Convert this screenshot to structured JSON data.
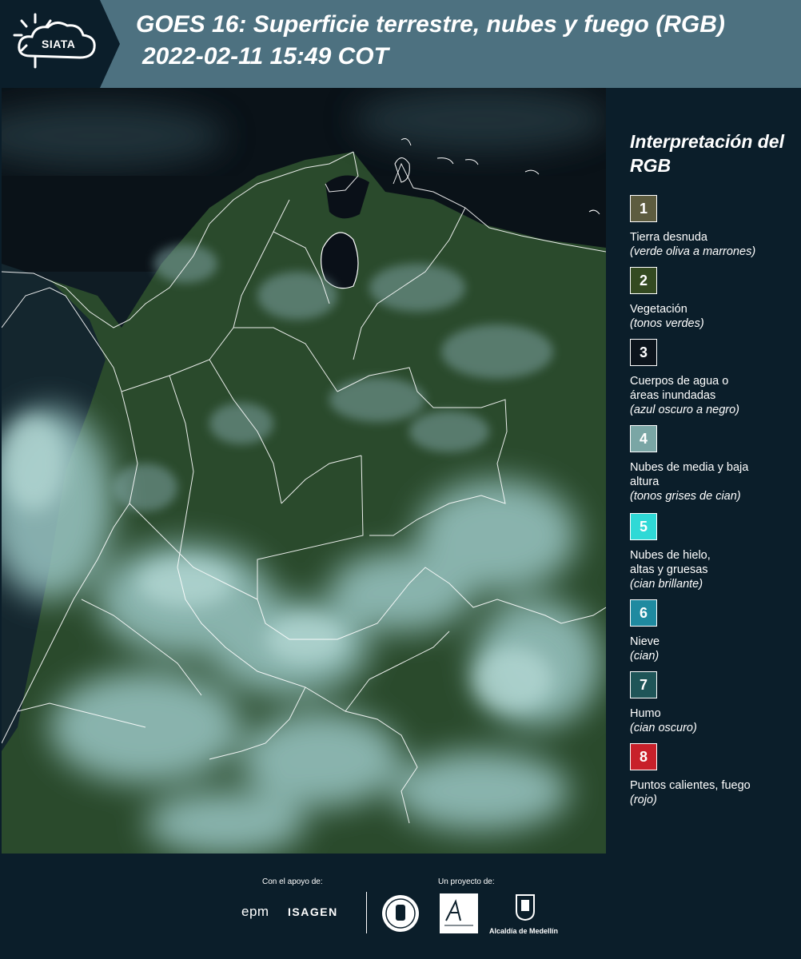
{
  "header": {
    "logo_text": "SIATA",
    "title_line1": "GOES 16: Superficie terrestre, nubes y fuego (RGB)",
    "title_line2": "2022-02-11 15:49 COT"
  },
  "legend": {
    "title": "Interpretación del RGB",
    "items": [
      {
        "number": "1",
        "label": "Tierra desnuda",
        "note": "(verde oliva a marrones)",
        "color": "#5d5c3f"
      },
      {
        "number": "2",
        "label": "Vegetación",
        "note": "(tonos verdes)",
        "color": "#344a21"
      },
      {
        "number": "3",
        "label": "Cuerpos de agua o áreas inundadas",
        "note": "(azul oscuro a negro)",
        "color": "#0c141c"
      },
      {
        "number": "4",
        "label": "Nubes de media y baja altura",
        "note": "(tonos grises de cian)",
        "color": "#7aa6a5"
      },
      {
        "number": "5",
        "label": "Nubes de hielo, altas y gruesas",
        "note": "(cian brillante)",
        "color": "#2fd9d6"
      },
      {
        "number": "6",
        "label": "Nieve",
        "note": "(cian)",
        "color": "#1f8aa0"
      },
      {
        "number": "7",
        "label": "Humo",
        "note": "(cian oscuro)",
        "color": "#1f5558"
      },
      {
        "number": "8",
        "label": "Puntos calientes, fuego",
        "note": "(rojo)",
        "color": "#c8202a"
      }
    ]
  },
  "footer": {
    "support_label": "Con el apoyo de:",
    "project_label": "Un proyecto de:",
    "epm": "epm",
    "isagen": "ISAGEN",
    "alcaldia": "Alcaldía de Medellín"
  },
  "colors": {
    "header_bg": "#4d7180",
    "panel_bg": "#0b1e2a",
    "land": "#2c4a2c",
    "water": "#0a1018",
    "cloud": "#8fb9b9"
  }
}
